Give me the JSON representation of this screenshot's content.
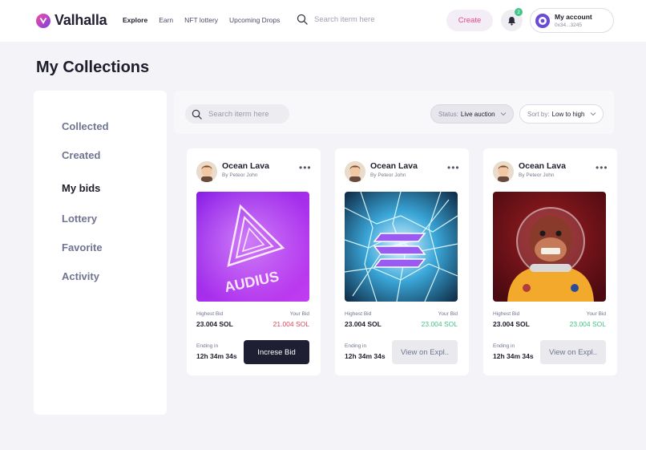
{
  "app": {
    "name": "Valhalla"
  },
  "nav": {
    "items": [
      "Explore",
      "Earn",
      "NFT lottery",
      "Upcoming Drops"
    ],
    "active": "Explore"
  },
  "search_top": {
    "placeholder": "Search iterm here"
  },
  "header": {
    "create_label": "Create",
    "notification_count": "2",
    "account_name": "My account",
    "account_address": "0x34...3245"
  },
  "page": {
    "title": "My Collections"
  },
  "sidebar": {
    "items": [
      {
        "label": "Collected"
      },
      {
        "label": "Created"
      },
      {
        "label": "My bids",
        "active": true
      },
      {
        "label": "Lottery"
      },
      {
        "label": "Favorite"
      },
      {
        "label": "Activity"
      }
    ]
  },
  "filters": {
    "search_placeholder": "Search iterm here",
    "status_label": "Status:",
    "status_value": "Live auction",
    "sort_label": "Sort by:",
    "sort_value": "Low to high"
  },
  "colors": {
    "accent_pink": "#e0488b",
    "red": "#e0485a",
    "green": "#3fc48a",
    "dark_button": "#1e1f33"
  },
  "cards": [
    {
      "title": "Ocean Lava",
      "creator": "By Peteor John",
      "more": "•••",
      "highest_bid_label": "Highest Bid",
      "highest_bid": "23.004 SOL",
      "your_bid_label": "Your Bid",
      "your_bid": "21.004 SOL",
      "your_bid_color": "#e0485a",
      "ending_label": "Ending in",
      "ending": "12h 34m 34s",
      "button": "Increse Bid",
      "art_text": "AUDIUS"
    },
    {
      "title": "Ocean Lava",
      "creator": "By Peteor John",
      "more": "•••",
      "highest_bid_label": "Highest Bid",
      "highest_bid": "23.004 SOL",
      "your_bid_label": "Your Bid",
      "your_bid": "23.004 SOL",
      "your_bid_color": "#3fc48a",
      "ending_label": "Ending in",
      "ending": "12h 34m 34s",
      "button": "View on Expl.."
    },
    {
      "title": "Ocean Lava",
      "creator": "By Peteor John",
      "more": "•••",
      "highest_bid_label": "Highest Bid",
      "highest_bid": "23.004 SOL",
      "your_bid_label": "Your Bid",
      "your_bid": "23.004 SOL",
      "your_bid_color": "#3fc48a",
      "ending_label": "Ending in",
      "ending": "12h 34m 34s",
      "button": "View on Expl.."
    }
  ]
}
